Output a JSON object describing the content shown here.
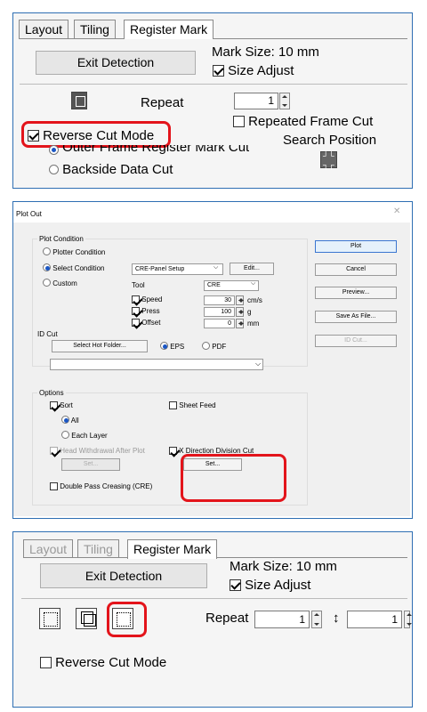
{
  "top_panel": {
    "tabs": [
      "Layout",
      "Tiling",
      "Register Mark"
    ],
    "exit_button": "Exit Detection",
    "mark_size": "Mark Size: 10 mm",
    "size_adjust": "Size Adjust",
    "repeat_label": "Repeat",
    "repeat_value": "1",
    "repeated_frame_cut": "Repeated Frame Cut",
    "reverse_cut_mode": "Reverse Cut Mode",
    "search_position": "Search Position",
    "outer_frame": "Outer Frame Register Mark Cut",
    "backside": "Backside Data Cut"
  },
  "plot_dialog": {
    "title": "Plot Out",
    "plot_condition": "Plot Condition",
    "plotter_condition": "Plotter Condition",
    "select_condition": "Select Condition",
    "custom": "Custom",
    "condition_value": "CRE-Panel Setup",
    "edit_button": "Edit...",
    "tool_label": "Tool",
    "tool_value": "CRE",
    "speed": "Speed",
    "speed_value": "30",
    "speed_unit": "cm/s",
    "press": "Press",
    "press_value": "100",
    "press_unit": "g",
    "offset": "Offset",
    "offset_value": "0",
    "offset_unit": "mm",
    "id_cut": "ID Cut",
    "select_hot_folder": "Select Hot Folder...",
    "eps": "EPS",
    "pdf": "PDF",
    "buttons": [
      "Plot",
      "Cancel",
      "Preview...",
      "Save As File...",
      "ID Cut..."
    ],
    "options": "Options",
    "sort": "Sort",
    "all": "All",
    "each_layer": "Each Layer",
    "sheet_feed": "Sheet Feed",
    "head_withdrawal": "Head Withdrawal After Plot",
    "set_button": "Set...",
    "x_direction": "X Direction Division Cut",
    "set_button2": "Set...",
    "double_pass": "Double Pass Creasing (CRE)"
  },
  "bottom_panel": {
    "tabs": [
      "Layout",
      "Tiling",
      "Register Mark"
    ],
    "exit_button": "Exit Detection",
    "mark_size": "Mark Size: 10 mm",
    "size_adjust": "Size Adjust",
    "repeat_label": "Repeat",
    "horiz_symbol": "↔",
    "vert_symbol": "↕",
    "repeat_x": "1",
    "repeat_y": "1",
    "reverse_cut_mode": "Reverse Cut Mode"
  }
}
